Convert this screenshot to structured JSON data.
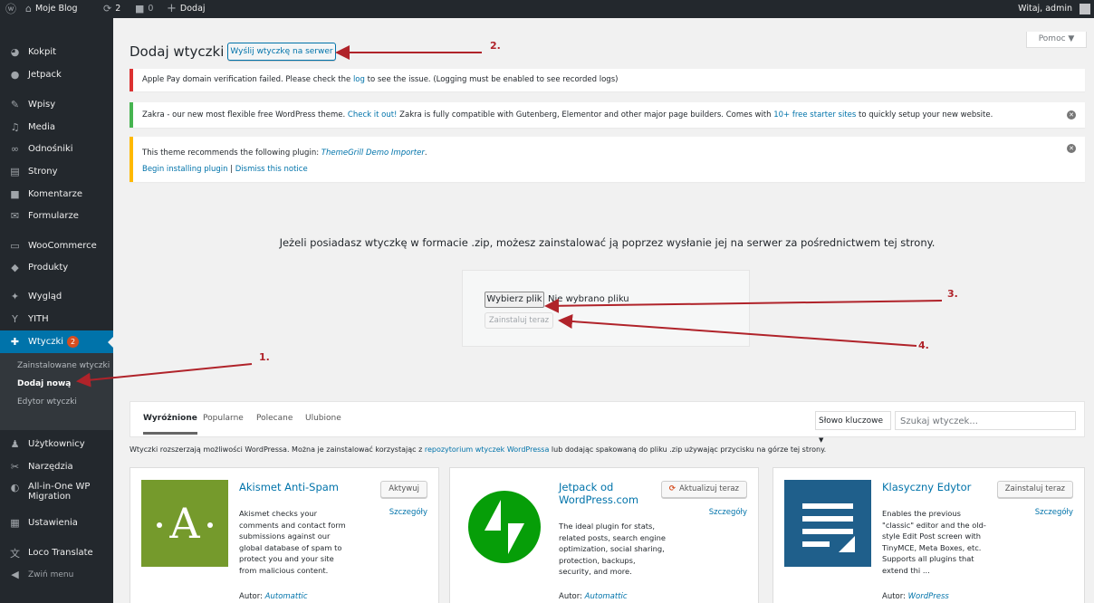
{
  "adminbar": {
    "site_name": "Moje Blog",
    "updates_count": "2",
    "comments_count": "0",
    "new_label": "Dodaj",
    "greeting": "Witaj, admin"
  },
  "sidebar": {
    "items": [
      {
        "label": "Kokpit",
        "icon": "dashboard-icon"
      },
      {
        "label": "Jetpack",
        "icon": "jetpack-icon"
      },
      {
        "label": "Wpisy",
        "icon": "pin-icon"
      },
      {
        "label": "Media",
        "icon": "media-icon"
      },
      {
        "label": "Odnośniki",
        "icon": "links-icon"
      },
      {
        "label": "Strony",
        "icon": "page-icon"
      },
      {
        "label": "Komentarze",
        "icon": "comment-icon"
      },
      {
        "label": "Formularze",
        "icon": "feedback-icon"
      },
      {
        "label": "WooCommerce",
        "icon": "woo-icon"
      },
      {
        "label": "Produkty",
        "icon": "products-icon"
      },
      {
        "label": "Wygląd",
        "icon": "appearance-icon"
      },
      {
        "label": "YITH",
        "icon": "yith-icon"
      },
      {
        "label": "Wtyczki",
        "icon": "plugins-icon",
        "badge": "2"
      },
      {
        "label": "Użytkownicy",
        "icon": "users-icon"
      },
      {
        "label": "Narzędzia",
        "icon": "tools-icon"
      },
      {
        "label": "All-in-One WP",
        "label2": "Migration",
        "icon": "migration-icon"
      },
      {
        "label": "Ustawienia",
        "icon": "settings-icon"
      },
      {
        "label": "Loco Translate",
        "icon": "translate-icon"
      },
      {
        "label": "Zwiń menu",
        "icon": "collapse-icon"
      }
    ],
    "submenu": [
      "Zainstalowane wtyczki",
      "Dodaj nową",
      "Edytor wtyczki"
    ]
  },
  "page": {
    "title": "Dodaj wtyczki",
    "upload_button": "Wyślij wtyczkę na serwer",
    "help": "Pomoc ▼"
  },
  "notices": {
    "applepay_pre": "Apple Pay domain verification failed. Please check the ",
    "applepay_link": "log",
    "applepay_post": " to see the issue. (Logging must be enabled to see recorded logs)",
    "zakra_pre": "Zakra - our new most flexible free WordPress theme. ",
    "zakra_link1": "Check it out!",
    "zakra_mid": " Zakra is fully compatible with Gutenberg, Elementor and other major page builders. Comes with ",
    "zakra_link2": "10+ free starter sites",
    "zakra_post": " to quickly setup your new website.",
    "theme_pre": "This theme recommends the following plugin: ",
    "theme_link": "ThemeGrill Demo Importer",
    "theme_post": ".",
    "begin_install": "Begin installing plugin",
    "sep": " | ",
    "dismiss": "Dismiss this notice"
  },
  "upload": {
    "text": "Jeżeli posiadasz wtyczkę w formacie .zip, możesz zainstalować ją poprzez wysłanie jej na serwer za pośrednictwem tej strony.",
    "choose": "Wybierz plik",
    "no_file": "Nie wybrano pliku",
    "install": "Zainstaluj teraz"
  },
  "filter": {
    "tabs": [
      "Wyróżnione",
      "Popularne",
      "Polecane",
      "Ulubione"
    ],
    "search_type": "Słowo kluczowe",
    "search_placeholder": "Szukaj wtyczek..."
  },
  "description": {
    "pre": "Wtyczki rozszerzają możliwości WordPressa. Można je zainstalować korzystając z ",
    "link": "repozytorium wtyczek WordPressa",
    "post": " lub dodając spakowaną do pliku .zip używając przycisku na górze tej strony."
  },
  "plugins": [
    {
      "name": "Akismet Anti-Spam",
      "action": "Aktywuj",
      "details": "Szczegóły",
      "desc": [
        "Akismet checks your",
        "comments and contact form",
        "submissions against our",
        "global database of spam to",
        "protect you and your site",
        "from malicious content."
      ],
      "author_label": "Autor: ",
      "author": "Automattic",
      "icon": "akismet-icon"
    },
    {
      "name_line1": "Jetpack od",
      "name_line2": "WordPress.com",
      "action": "Aktualizuj teraz",
      "details": "Szczegóły",
      "desc": [
        "The ideal plugin for stats,",
        "related posts, search engine",
        "optimization, social sharing,",
        "protection, backups,",
        "security, and more."
      ],
      "author_label": "Autor: ",
      "author": "Automattic",
      "icon": "jetpack-logo-icon"
    },
    {
      "name": "Klasyczny Edytor",
      "action": "Zainstaluj teraz",
      "details": "Szczegóły",
      "desc": [
        "Enables the previous",
        "\"classic\" editor and the old-",
        "style Edit Post screen with",
        "TinyMCE, Meta Boxes, etc.",
        "Supports all plugins that",
        "extend thi ..."
      ],
      "author_label": "Autor: ",
      "author": "WordPress",
      "icon": "classic-editor-icon"
    }
  ],
  "annotations": [
    "1.",
    "2.",
    "3.",
    "4."
  ],
  "colors": {
    "adminbar": "#23282d",
    "sidebar": "#23282d",
    "active": "#0073aa",
    "link": "#0073aa",
    "error_border": "#dc3232",
    "success_border": "#46b450",
    "warning_border": "#ffb900",
    "arrow": "#b0232a",
    "akismet_bg": "#759a2c",
    "jetpack_green": "#069e08",
    "classic_blue": "#1f5f8b"
  }
}
